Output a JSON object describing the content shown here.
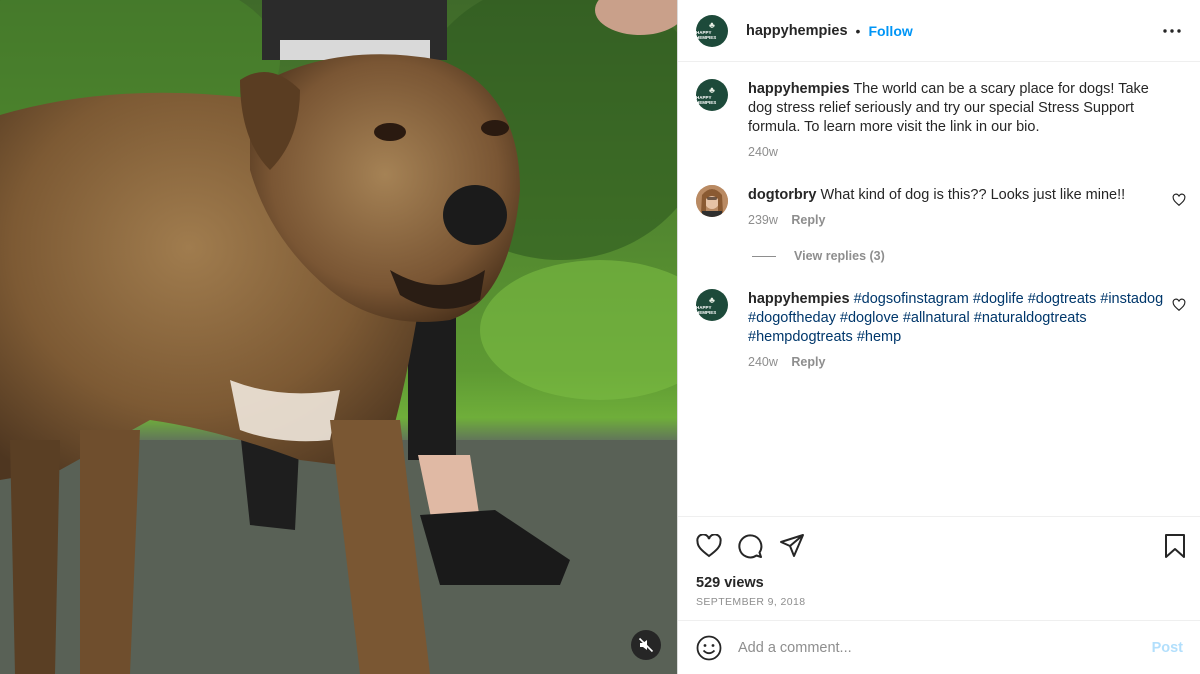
{
  "post": {
    "account": "happyhempies",
    "avatar_text": "HAPPY HEMPIES",
    "follow_label": "Follow",
    "separator": "•",
    "more_icon": "more-options-icon"
  },
  "media": {
    "type": "video",
    "mute_icon": "muted-speaker-icon"
  },
  "caption": {
    "user": "happyhempies",
    "text": "The world can be a scary place for dogs! Take dog stress relief seriously and try our special Stress Support formula. To learn more visit the link in our bio.",
    "time": "240w"
  },
  "comments": [
    {
      "user": "dogtorbry",
      "text": "What kind of dog is this?? Looks just like mine!!",
      "time": "239w",
      "reply_label": "Reply",
      "view_replies": "View replies (3)"
    },
    {
      "user": "happyhempies",
      "hashtags": [
        "#dogsofinstagram",
        "#doglife",
        "#dogtreats",
        "#instadog",
        "#dogoftheday",
        "#doglove",
        "#allnatural",
        "#naturaldogtreats",
        "#hempdogtreats",
        "#hemp"
      ],
      "time": "240w",
      "reply_label": "Reply"
    }
  ],
  "actions": {
    "icons": [
      "heart-icon",
      "comment-icon",
      "share-icon",
      "bookmark-icon"
    ],
    "views": "529 views",
    "date": "SEPTEMBER 9, 2018"
  },
  "composer": {
    "placeholder": "Add a comment...",
    "post_label": "Post",
    "emoji_icon": "emoji-icon"
  },
  "colors": {
    "link": "#0095f6",
    "hashtag": "#00376b",
    "muted": "#8e8e8e",
    "avatar_bg": "#1d4a3a"
  }
}
